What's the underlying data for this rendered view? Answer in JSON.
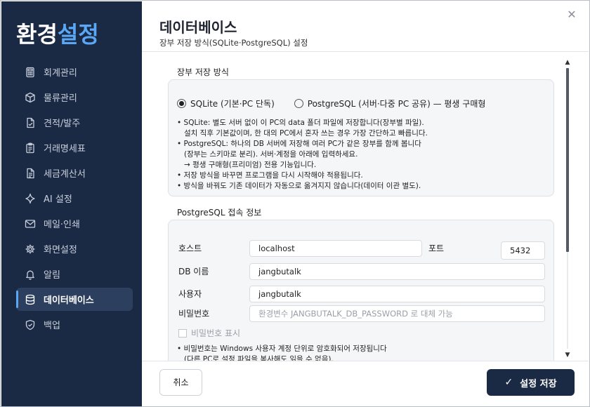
{
  "app": {
    "brand_part1": "환경",
    "brand_part2": "설정",
    "close_glyph": "✕"
  },
  "sidebar": {
    "items": [
      {
        "label": "회계관리",
        "icon": "calculator-icon",
        "active": false
      },
      {
        "label": "물류관리",
        "icon": "box-icon",
        "active": false
      },
      {
        "label": "견적/발주",
        "icon": "document-check-icon",
        "active": false
      },
      {
        "label": "거래명세표",
        "icon": "clipboard-icon",
        "active": false
      },
      {
        "label": "세금계산서",
        "icon": "document-lines-icon",
        "active": false
      },
      {
        "label": "AI 설정",
        "icon": "sparkle-icon",
        "active": false
      },
      {
        "label": "메일·인쇄",
        "icon": "mail-icon",
        "active": false
      },
      {
        "label": "화면설정",
        "icon": "gear-icon",
        "active": false
      },
      {
        "label": "알림",
        "icon": "bell-icon",
        "active": false
      },
      {
        "label": "데이터베이스",
        "icon": "database-icon",
        "active": true
      },
      {
        "label": "백업",
        "icon": "shield-check-icon",
        "active": false
      }
    ],
    "accent_color": "#5aa7f5",
    "background_color": "#1b2a44"
  },
  "header": {
    "title": "데이터베이스",
    "subtitle": "장부 저장 방식(SQLite·PostgreSQL) 설정"
  },
  "storage": {
    "section_label": "장부 저장 방식",
    "option_sqlite": "SQLite (기본·PC 단독)",
    "option_postgres": "PostgreSQL (서버·다중 PC 공유) — 평생 구매형",
    "selected": "sqlite",
    "notes": [
      "• SQLite: 별도 서버 없이 이 PC의 data 폴더 파일에 저장합니다(장부별 파일).",
      "   설치 직후 기본값이며, 한 대의 PC에서 혼자 쓰는 경우 가장 간단하고 빠릅니다.",
      "• PostgreSQL: 하나의 DB 서버에 저장해 여러 PC가 같은 장부를 함께 봅니다",
      "   (장부는 스키마로 분리). 서버·계정을 아래에 입력하세요.",
      "   → 평생 구매형(프리미엄) 전용 기능입니다.",
      "• 저장 방식을 바꾸면 프로그램을 다시 시작해야 적용됩니다.",
      "• 방식을 바꿔도 기존 데이터가 자동으로 옮겨지지 않습니다(데이터 이관 별도)."
    ]
  },
  "postgres": {
    "section_label": "PostgreSQL 접속 정보",
    "host_label": "호스트",
    "host_value": "localhost",
    "port_label": "포트",
    "port_value": "5432",
    "db_label": "DB 이름",
    "db_value": "jangbutalk",
    "user_label": "사용자",
    "user_value": "jangbutalk",
    "password_label": "비밀번호",
    "password_placeholder": "환경변수 JANGBUTALK_DB_PASSWORD 로 대체 가능",
    "show_password_label": "비밀번호 표시",
    "show_password_checked": false,
    "notes": [
      "• 비밀번호는 Windows 사용자 계정 단위로 암호화되어 저장됩니다",
      "   (다른 PC로 설정 파일을 복사해도 읽을 수 없음)."
    ]
  },
  "footer": {
    "cancel_label": "취소",
    "save_label": "설정 저장",
    "save_glyph": "✓"
  },
  "scrollbar": {
    "up_glyph": "▲",
    "down_glyph": "▼"
  }
}
